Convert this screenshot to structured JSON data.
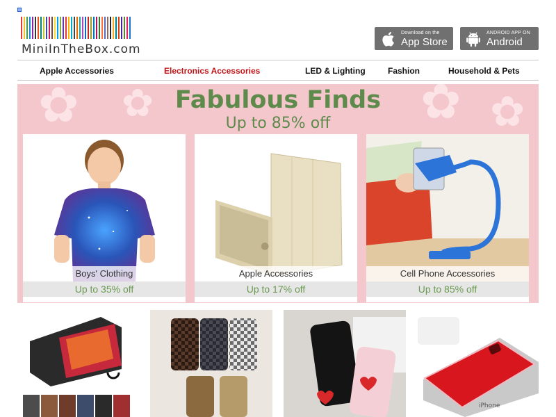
{
  "logo": {
    "text": "MiniInTheBox.com",
    "barcode_colors": [
      "#e53935",
      "#fbc02d",
      "#43a047",
      "#1e88e5",
      "#8e24aa",
      "#333333",
      "#f4511e",
      "#00897b",
      "#c0ca33",
      "#3949ab",
      "#d81b60",
      "#6d4c41",
      "#fdd835",
      "#039be5",
      "#7cb342",
      "#5e35b1",
      "#e53935",
      "#ffb300",
      "#00acc1",
      "#444444",
      "#ef6c00",
      "#26a69a",
      "#ab47bc",
      "#1565c0",
      "#c62828",
      "#9e9d24",
      "#0277bd",
      "#ad1457",
      "#2e7d32",
      "#ff7043",
      "#5c6bc0",
      "#8d6e63",
      "#222222",
      "#f9a825",
      "#00838f",
      "#d84315",
      "#4527a0",
      "#558b2f",
      "#e91e63",
      "#1976d2"
    ]
  },
  "app_store": {
    "small": "Download on the",
    "big": "App Store",
    "icon": "apple-icon"
  },
  "android": {
    "small": "ANDROID APP ON",
    "big": "Android",
    "icon": "android-icon"
  },
  "nav": {
    "items": [
      {
        "label": "Apple Accessories"
      },
      {
        "label": "Electronics Accessories",
        "active": true
      },
      {
        "label": "LED & Lighting"
      },
      {
        "label": "Fashion"
      },
      {
        "label": "Household & Pets"
      }
    ]
  },
  "banner": {
    "title": "Fabulous Finds",
    "subtitle": "Up to 85% off",
    "background": "#f4c7cd",
    "title_color": "#5e8a4c",
    "cards": [
      {
        "caption": "Boys' Clothing",
        "offer": "Up to 35% off"
      },
      {
        "caption": "Apple Accessories",
        "offer": "Up to 17% off"
      },
      {
        "caption": "Cell Phone Accessories",
        "offer": "Up to 85% off"
      }
    ]
  },
  "products": [
    {
      "name": "leather-flip-phone-case"
    },
    {
      "name": "checkered-phone-cases"
    },
    {
      "name": "heart-phone-cases"
    },
    {
      "name": "red-clear-phone-case"
    }
  ]
}
